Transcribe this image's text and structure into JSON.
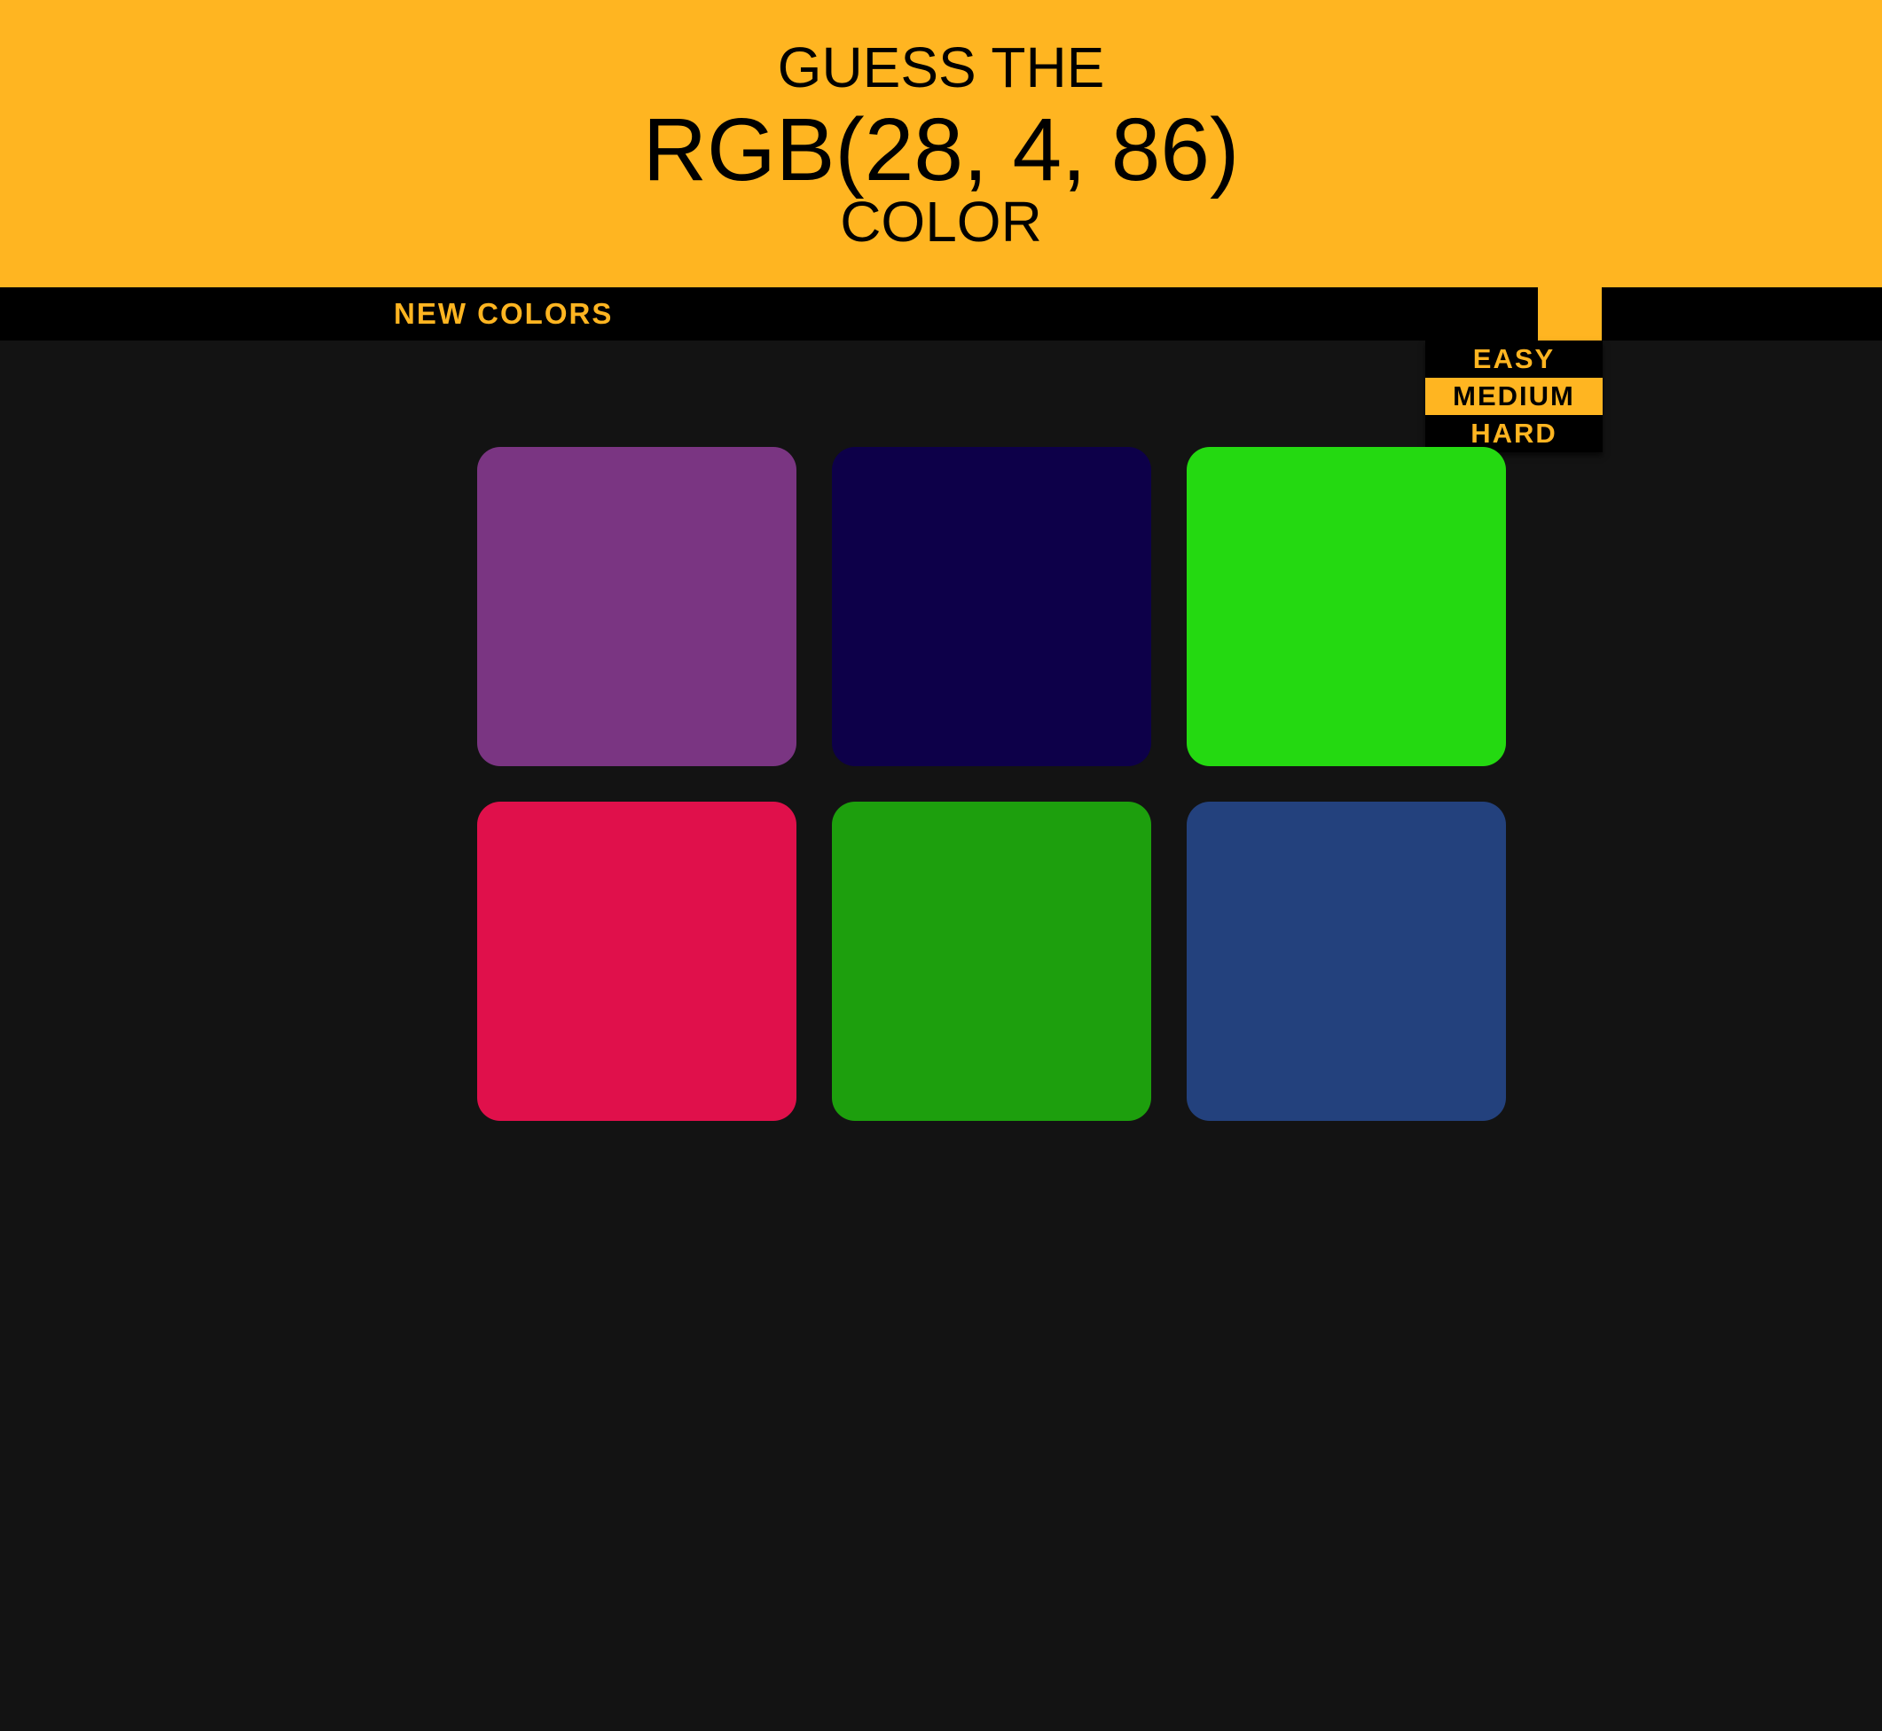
{
  "header": {
    "line1": "GUESS THE",
    "rgb": "RGB(28, 4, 86)",
    "line3": "COLOR"
  },
  "toolbar": {
    "new_colors_label": "NEW COLORS"
  },
  "mode_menu": {
    "items": [
      {
        "label": "EASY",
        "selected": false
      },
      {
        "label": "MEDIUM",
        "selected": true
      },
      {
        "label": "HARD",
        "selected": false
      }
    ]
  },
  "squares": [
    "#7a3582",
    "#0d0049",
    "#24d911",
    "#e0104b",
    "#1d9f0d",
    "#23417d"
  ],
  "colors": {
    "accent": "#ffb521",
    "background": "#131313",
    "toolbar": "#000000"
  }
}
